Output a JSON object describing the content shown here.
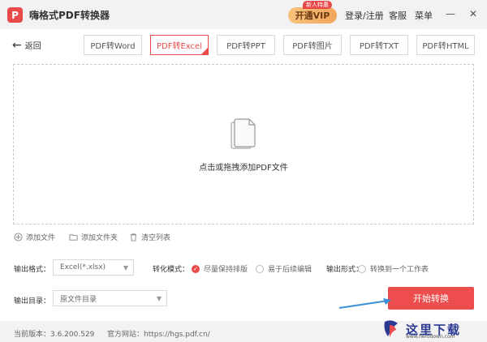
{
  "titlebar": {
    "logo_text": "P",
    "app_title": "嗨格式PDF转换器",
    "vip_label": "开通VIP",
    "vip_badge": "新人特惠",
    "login_label": "登录/注册",
    "service_label": "客服",
    "menu_label": "菜单",
    "minimize_glyph": "—",
    "close_glyph": "✕"
  },
  "toolbar": {
    "back_label": "返回",
    "tabs": [
      {
        "label": "PDF转Word",
        "active": false
      },
      {
        "label": "PDF转Excel",
        "active": true
      },
      {
        "label": "PDF转PPT",
        "active": false
      },
      {
        "label": "PDF转图片",
        "active": false
      },
      {
        "label": "PDF转TXT",
        "active": false
      },
      {
        "label": "PDF转HTML",
        "active": false
      }
    ]
  },
  "dropzone": {
    "text": "点击或拖拽添加PDF文件"
  },
  "actions": {
    "add_file": "添加文件",
    "add_folder": "添加文件夹",
    "clear_list": "清空列表"
  },
  "options": {
    "output_format_label": "输出格式：",
    "output_format_value": "Excel(*.xlsx)",
    "mode_label": "转化模式：",
    "mode_option_1": "尽量保持排版",
    "mode_option_2": "易于后续编辑",
    "output_form_label": "输出形式：",
    "output_form_option": "转换到一个工作表",
    "output_dir_label": "输出目录：",
    "output_dir_value": "原文件目录"
  },
  "start_button": "开始转换",
  "footer": {
    "version": "当前版本：3.6.200.529",
    "website": "官方网站：https://hgs.pdf.cn/"
  },
  "watermark": {
    "text": "这里下载",
    "url": "www.herodown.com"
  },
  "colors": {
    "accent": "#e94b4b",
    "titlebar_bg": "#f2f2f2",
    "vip_gold": "#f3a65c"
  }
}
